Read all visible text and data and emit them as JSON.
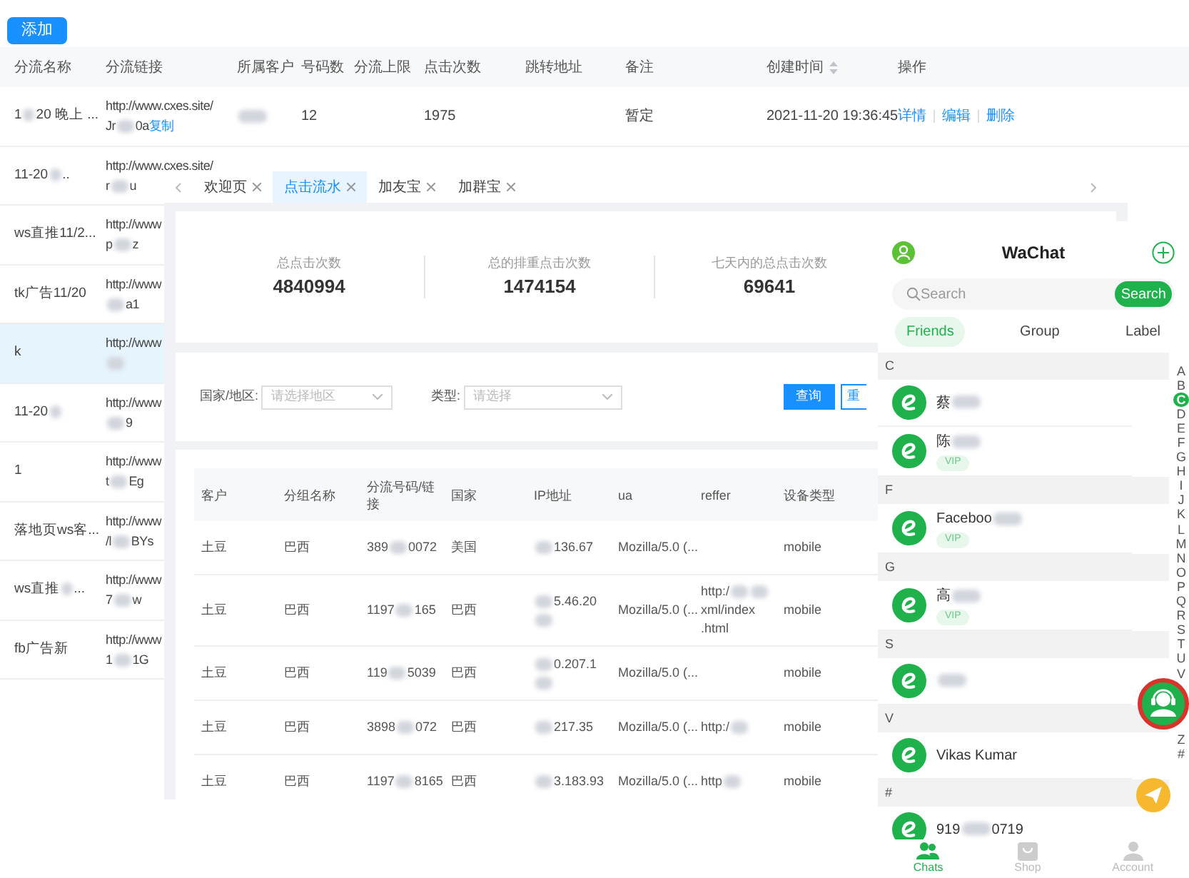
{
  "toolbar": {
    "add_button": "添加"
  },
  "list_table": {
    "columns": [
      {
        "label": "分流名称",
        "kind": "plain"
      },
      {
        "label": "分流链接",
        "kind": "plain"
      },
      {
        "label": "所属客户",
        "kind": "plain"
      },
      {
        "label": "号码数",
        "kind": "plain"
      },
      {
        "label": "分流上限",
        "kind": "plain"
      },
      {
        "label": "点击次数",
        "kind": "plain"
      },
      {
        "label": "跳转地址",
        "kind": "plain"
      },
      {
        "label": "备注",
        "kind": "plain"
      },
      {
        "label": "创建时间",
        "kind": "sortable"
      },
      {
        "label": "操作",
        "kind": "plain"
      }
    ],
    "rows": [
      {
        "selected": false,
        "name": [
          "1",
          {
            "kind": "blur"
          },
          "20 晚上 ..."
        ],
        "link": "http://www.cxes.site/",
        "link_tail": [
          "Jr",
          {
            "kind": "blur"
          },
          "0a"
        ],
        "copy": "复制",
        "customer": [
          {
            "kind": "blur"
          }
        ],
        "count": "12",
        "clicks": "1975",
        "note": "暂定",
        "created": "2021-11-20 19:36:45",
        "actions": [
          "详情",
          "编辑",
          "删除"
        ]
      },
      {
        "selected": false,
        "name": [
          "11-20",
          {
            "kind": "blur"
          },
          ".."
        ],
        "link": "http://www.cxes.site/",
        "link_tail": [
          "r",
          {
            "kind": "blur"
          },
          "u"
        ]
      },
      {
        "selected": false,
        "name": [
          "ws直推11/2..."
        ],
        "link": "http://www",
        "link_tail": [
          "p",
          {
            "kind": "blur"
          },
          "z"
        ]
      },
      {
        "selected": false,
        "name": [
          "tk广告11/20"
        ],
        "link": "http://www",
        "link_tail": [
          {
            "kind": "blur"
          },
          "a1"
        ]
      },
      {
        "selected": true,
        "name": [
          "k"
        ],
        "link": "http://www",
        "link_tail": [
          {
            "kind": "blur"
          }
        ]
      },
      {
        "selected": false,
        "name": [
          "11-20",
          {
            "kind": "blur"
          }
        ],
        "link": "http://www",
        "link_tail": [
          {
            "kind": "blur"
          },
          "9"
        ]
      },
      {
        "selected": false,
        "name": [
          "1"
        ],
        "link": "http://www",
        "link_tail": [
          "t",
          {
            "kind": "blur"
          },
          "Eg"
        ]
      },
      {
        "selected": false,
        "name": [
          "落地页ws客..."
        ],
        "link": "http://www",
        "link_tail": [
          "/l",
          {
            "kind": "blur"
          },
          "BYs"
        ]
      },
      {
        "selected": false,
        "name": [
          "ws直推",
          {
            "kind": "blur"
          },
          "..."
        ],
        "link": "http://www",
        "link_tail": [
          "7",
          {
            "kind": "blur"
          },
          "w"
        ]
      },
      {
        "selected": false,
        "name": [
          "fb广告新"
        ],
        "link": "http://www",
        "link_tail": [
          "1",
          {
            "kind": "blur"
          },
          "1G"
        ]
      }
    ]
  },
  "clicks_window": {
    "tabs": [
      {
        "label": "欢迎页",
        "selected": false
      },
      {
        "label": "点击流水",
        "selected": true
      },
      {
        "label": "加友宝",
        "selected": false
      },
      {
        "label": "加群宝",
        "selected": false
      }
    ],
    "stats": [
      {
        "label": "总点击次数",
        "value": "4840994"
      },
      {
        "label": "总的排重点击次数",
        "value": "1474154"
      },
      {
        "label": "七天内的总点击次数",
        "value": "69641"
      }
    ],
    "filters": [
      {
        "label": "国家/地区:",
        "placeholder": "请选择地区"
      },
      {
        "label": "类型:",
        "placeholder": "请选择"
      }
    ],
    "buttons": [
      {
        "label": "查询",
        "kind": "primary"
      },
      {
        "label": "重",
        "kind": "default"
      }
    ],
    "table": {
      "columns": [
        "客户",
        "分组名称",
        "分流号码/链接",
        "国家",
        "IP地址",
        "ua",
        "reffer",
        "设备类型"
      ],
      "rows": [
        {
          "customer": [
            "土豆"
          ],
          "group": [
            "巴西"
          ],
          "number": [
            "389",
            {
              "kind": "blur"
            },
            "0072"
          ],
          "country": [
            "美国"
          ],
          "ip": [
            {
              "kind": "blur"
            },
            " 136.67"
          ],
          "ua": [
            "Mozilla/5.0 (..."
          ],
          "device": [
            "mobile"
          ]
        },
        {
          "customer": [
            "土豆"
          ],
          "group": [
            "巴西"
          ],
          "number": [
            "1197",
            {
              "kind": "blur"
            },
            "165"
          ],
          "country": [
            "巴西"
          ],
          "ip": [
            {
              "kind": "blur"
            },
            "5.46.20",
            {
              "kind": "blur"
            }
          ],
          "ua": [
            "Mozilla/5.0 (..."
          ],
          "reffer": [
            "http:/",
            {
              "kind": "blur"
            },
            {
              "kind": "blur"
            },
            "xml/index",
            ".html"
          ],
          "device": [
            "mobile"
          ]
        },
        {
          "customer": [
            "土豆"
          ],
          "group": [
            "巴西"
          ],
          "number": [
            "119",
            {
              "kind": "blur"
            },
            "5039"
          ],
          "country": [
            "巴西"
          ],
          "ip": [
            {
              "kind": "blur"
            },
            "0.207.1",
            {
              "kind": "blur"
            }
          ],
          "ua": [
            "Mozilla/5.0 (..."
          ],
          "device": [
            "mobile"
          ]
        },
        {
          "customer": [
            "土豆"
          ],
          "group": [
            "巴西"
          ],
          "number": [
            "3898",
            {
              "kind": "blur"
            },
            "072"
          ],
          "country": [
            "巴西"
          ],
          "ip": [
            {
              "kind": "blur"
            },
            "217.35"
          ],
          "ua": [
            "Mozilla/5.0 (..."
          ],
          "reffer": [
            "http:/",
            {
              "kind": "blur"
            }
          ],
          "device": [
            "mobile"
          ]
        },
        {
          "customer": [
            "土豆"
          ],
          "group": [
            "巴西"
          ],
          "number": [
            "1197",
            {
              "kind": "blur"
            },
            "8165"
          ],
          "country": [
            "巴西"
          ],
          "ip": [
            {
              "kind": "blur"
            },
            "3.183.93"
          ],
          "ua": [
            "Mozilla/5.0 (..."
          ],
          "reffer": [
            "http",
            {
              "kind": "blur"
            }
          ],
          "device": [
            "mobile"
          ]
        }
      ]
    }
  },
  "chat_app": {
    "title": "WaChat",
    "search": {
      "placeholder": "Search",
      "button": "Search"
    },
    "tabs": [
      {
        "label": "Friends",
        "selected": true
      },
      {
        "label": "Group",
        "selected": false
      },
      {
        "label": "Label",
        "selected": false
      }
    ],
    "sections": [
      {
        "letter": "C",
        "contacts": [
          {
            "name": [
              "蔡",
              {
                "kind": "blur"
              }
            ]
          },
          {
            "name": [
              "陈",
              {
                "kind": "blur"
              }
            ],
            "badge": "VIP"
          }
        ]
      },
      {
        "letter": "F",
        "contacts": [
          {
            "name": [
              "Faceboo",
              {
                "kind": "blur"
              }
            ],
            "badge": "VIP"
          }
        ]
      },
      {
        "letter": "G",
        "contacts": [
          {
            "name": [
              "高",
              {
                "kind": "blur"
              }
            ],
            "badge": "VIP"
          }
        ]
      },
      {
        "letter": "S",
        "contacts": [
          {
            "name": [
              {
                "kind": "blur"
              }
            ]
          }
        ]
      },
      {
        "letter": "V",
        "contacts": [
          {
            "name": [
              "Vikas Kumar"
            ]
          }
        ]
      },
      {
        "letter": "#",
        "contacts": [
          {
            "name": [
              "919",
              {
                "kind": "blur"
              },
              "0719"
            ]
          }
        ]
      }
    ],
    "index_top": [
      {
        "letter": "A",
        "selected": false
      },
      {
        "letter": "B",
        "selected": false
      },
      {
        "letter": "C",
        "selected": true
      },
      {
        "letter": "D",
        "selected": false
      },
      {
        "letter": "E",
        "selected": false
      },
      {
        "letter": "F",
        "selected": false
      },
      {
        "letter": "G",
        "selected": false
      },
      {
        "letter": "H",
        "selected": false
      },
      {
        "letter": "I",
        "selected": false
      },
      {
        "letter": "J",
        "selected": false
      },
      {
        "letter": "K",
        "selected": false
      },
      {
        "letter": "L",
        "selected": false
      },
      {
        "letter": "M",
        "selected": false
      },
      {
        "letter": "N",
        "selected": false
      },
      {
        "letter": "O",
        "selected": false
      },
      {
        "letter": "P",
        "selected": false
      },
      {
        "letter": "Q",
        "selected": false
      },
      {
        "letter": "R",
        "selected": false
      },
      {
        "letter": "S",
        "selected": false
      },
      {
        "letter": "T",
        "selected": false
      },
      {
        "letter": "U",
        "selected": false
      },
      {
        "letter": "V",
        "selected": false
      }
    ],
    "index_bottom": [
      {
        "letter": "Z",
        "selected": false
      },
      {
        "letter": "#",
        "selected": false
      }
    ],
    "nav": [
      {
        "label": "Chats",
        "kind": "chats",
        "selected": true
      },
      {
        "label": "Shop",
        "kind": "shop",
        "selected": false
      },
      {
        "label": "Account",
        "kind": "account",
        "selected": false
      }
    ]
  }
}
